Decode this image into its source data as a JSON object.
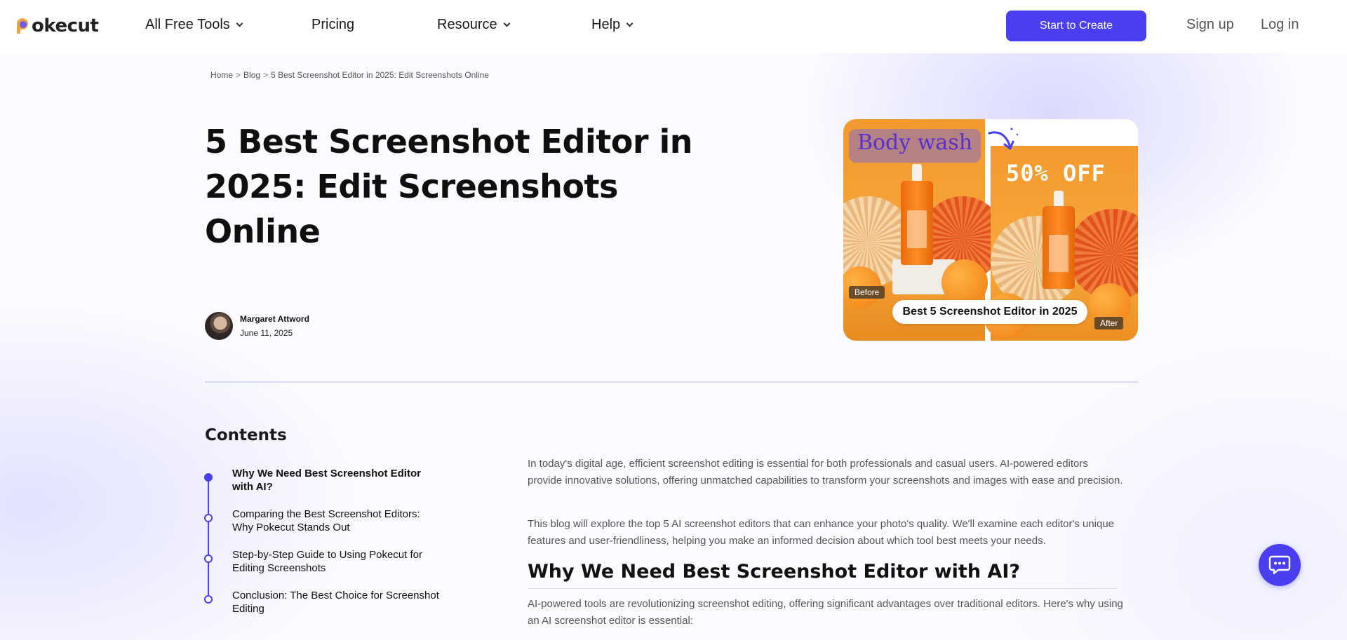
{
  "header": {
    "logo_text": "okecut",
    "nav": [
      {
        "label": "All Free Tools",
        "has_dropdown": true
      },
      {
        "label": "Pricing",
        "has_dropdown": false
      },
      {
        "label": "Resource",
        "has_dropdown": true
      },
      {
        "label": "Help",
        "has_dropdown": true
      }
    ],
    "cta_label": "Start to Create",
    "signup_label": "Sign up",
    "login_label": "Log in"
  },
  "breadcrumb": {
    "home": "Home",
    "blog": "Blog",
    "current": "5 Best Screenshot Editor in 2025: Edit Screenshots Online",
    "separator": ">"
  },
  "article": {
    "title": "5 Best Screenshot Editor in 2025: Edit Screenshots Online",
    "author": "Margaret Attword",
    "date": "June 11, 2025",
    "hero": {
      "before_product_text": "Body wash",
      "after_promo_text": "50% OFF",
      "before_tag": "Before",
      "after_tag": "After",
      "caption": "Best 5 Screenshot Editor in 2025"
    },
    "paragraphs": [
      "In today's digital age, efficient screenshot editing is essential for both professionals and casual users. AI-powered editors provide innovative solutions, offering unmatched capabilities to transform your screenshots and images with ease and precision.",
      "This blog will explore the top 5 AI screenshot editors that can enhance your photo's quality. We'll examine each editor's unique features and user-friendliness, helping you make an informed decision about which tool best meets your needs."
    ],
    "section_heading": "Why We Need Best Screenshot Editor with AI?",
    "section_paragraph": "AI-powered tools are revolutionizing screenshot editing, offering significant advantages over traditional editors. Here's why using an AI screenshot editor is essential:"
  },
  "contents": {
    "title": "Contents",
    "items": [
      {
        "label": "Why We Need Best Screenshot Editor with AI?",
        "active": true
      },
      {
        "label": "Comparing the Best Screenshot Editors: Why Pokecut Stands Out",
        "active": false
      },
      {
        "label": "Step-by-Step Guide to Using Pokecut for Editing Screenshots",
        "active": false
      },
      {
        "label": "Conclusion: The Best Choice for Screenshot Editing",
        "active": false
      }
    ]
  },
  "icons": {
    "chat": "chat-bubble-icon",
    "dropdown": "chevron-down-icon"
  },
  "colors": {
    "accent": "#4a3ff0",
    "text": "#141414",
    "muted": "#555555"
  }
}
